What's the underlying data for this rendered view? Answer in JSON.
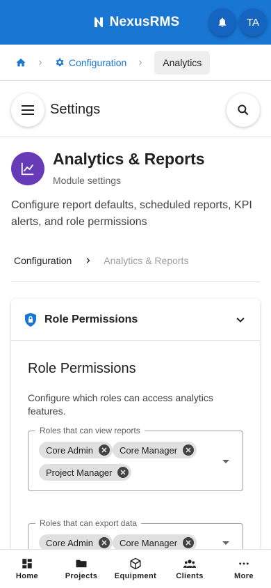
{
  "header": {
    "brand": "NexusRMS",
    "avatar_initials": "TA"
  },
  "breadcrumb": {
    "items": [
      "Configuration",
      "Analytics"
    ]
  },
  "settings": {
    "title": "Settings"
  },
  "module": {
    "title": "Analytics & Reports",
    "subtitle": "Module settings",
    "description": "Configure report defaults, scheduled reports, KPI alerts, and role permissions",
    "icon_color": "#673ab7"
  },
  "inner_breadcrumb": {
    "parent": "Configuration",
    "current": "Analytics & Reports"
  },
  "panel": {
    "header_label": "Role Permissions",
    "section_title": "Role Permissions",
    "section_description": "Configure which roles can access analytics features.",
    "fields": [
      {
        "label": "Roles that can view reports",
        "chips": [
          "Core Admin",
          "Core Manager",
          "Project Manager"
        ]
      },
      {
        "label": "Roles that can export data",
        "chips": [
          "Core Admin",
          "Core Manager"
        ]
      }
    ]
  },
  "bottom_nav": [
    {
      "label": "Home",
      "icon": "dashboard-icon"
    },
    {
      "label": "Projects",
      "icon": "folder-icon"
    },
    {
      "label": "Equipment",
      "icon": "cube-icon"
    },
    {
      "label": "Clients",
      "icon": "people-icon"
    },
    {
      "label": "More",
      "icon": "more-dots-icon"
    }
  ],
  "colors": {
    "primary": "#1976d2",
    "primary_dark": "#1565c0",
    "module_accent": "#673ab7"
  }
}
